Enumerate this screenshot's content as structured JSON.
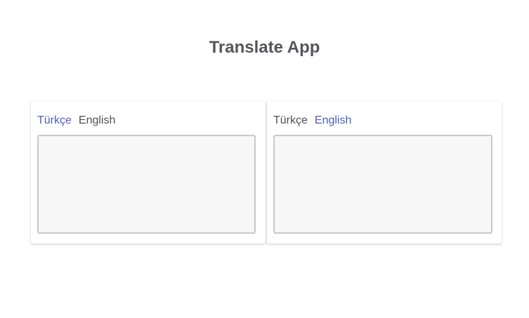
{
  "app": {
    "title": "Translate App"
  },
  "source_panel": {
    "tabs": [
      {
        "label": "Türkçe",
        "active": true
      },
      {
        "label": "English",
        "active": false
      }
    ],
    "text_value": ""
  },
  "target_panel": {
    "tabs": [
      {
        "label": "Türkçe",
        "active": false
      },
      {
        "label": "English",
        "active": true
      }
    ],
    "text_value": ""
  },
  "colors": {
    "active_tab": "#4a5fc1",
    "inactive_tab": "#505055",
    "title": "#55555d",
    "textarea_bg": "#f7f7f7",
    "textarea_border": "#c8c8c8"
  }
}
